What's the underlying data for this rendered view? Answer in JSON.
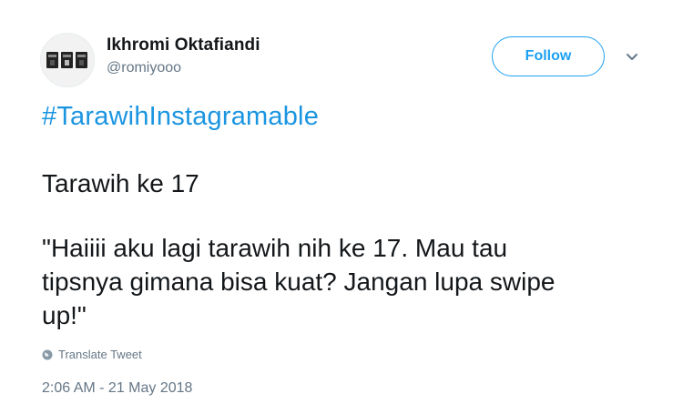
{
  "user": {
    "name": "Ikhromi Oktafiandi",
    "handle": "@romiyooo"
  },
  "follow_label": "Follow",
  "tweet": {
    "hashtag": "#TarawihInstagramable",
    "line1": "Tarawih ke 17",
    "quote_line1": "\"Haiiii aku lagi tarawih nih ke 17. Mau tau",
    "quote_line2": "tipsnya gimana bisa kuat? Jangan lupa swipe",
    "quote_line3": "up!\""
  },
  "translate_label": "Translate Tweet",
  "timestamp": "2:06 AM - 21 May 2018",
  "colors": {
    "accent": "#1da1f2",
    "hashtag": "#1b95e0",
    "secondary_text": "#657786"
  },
  "icons": {
    "caret": "chevron-down-icon",
    "translate": "globe-icon"
  }
}
